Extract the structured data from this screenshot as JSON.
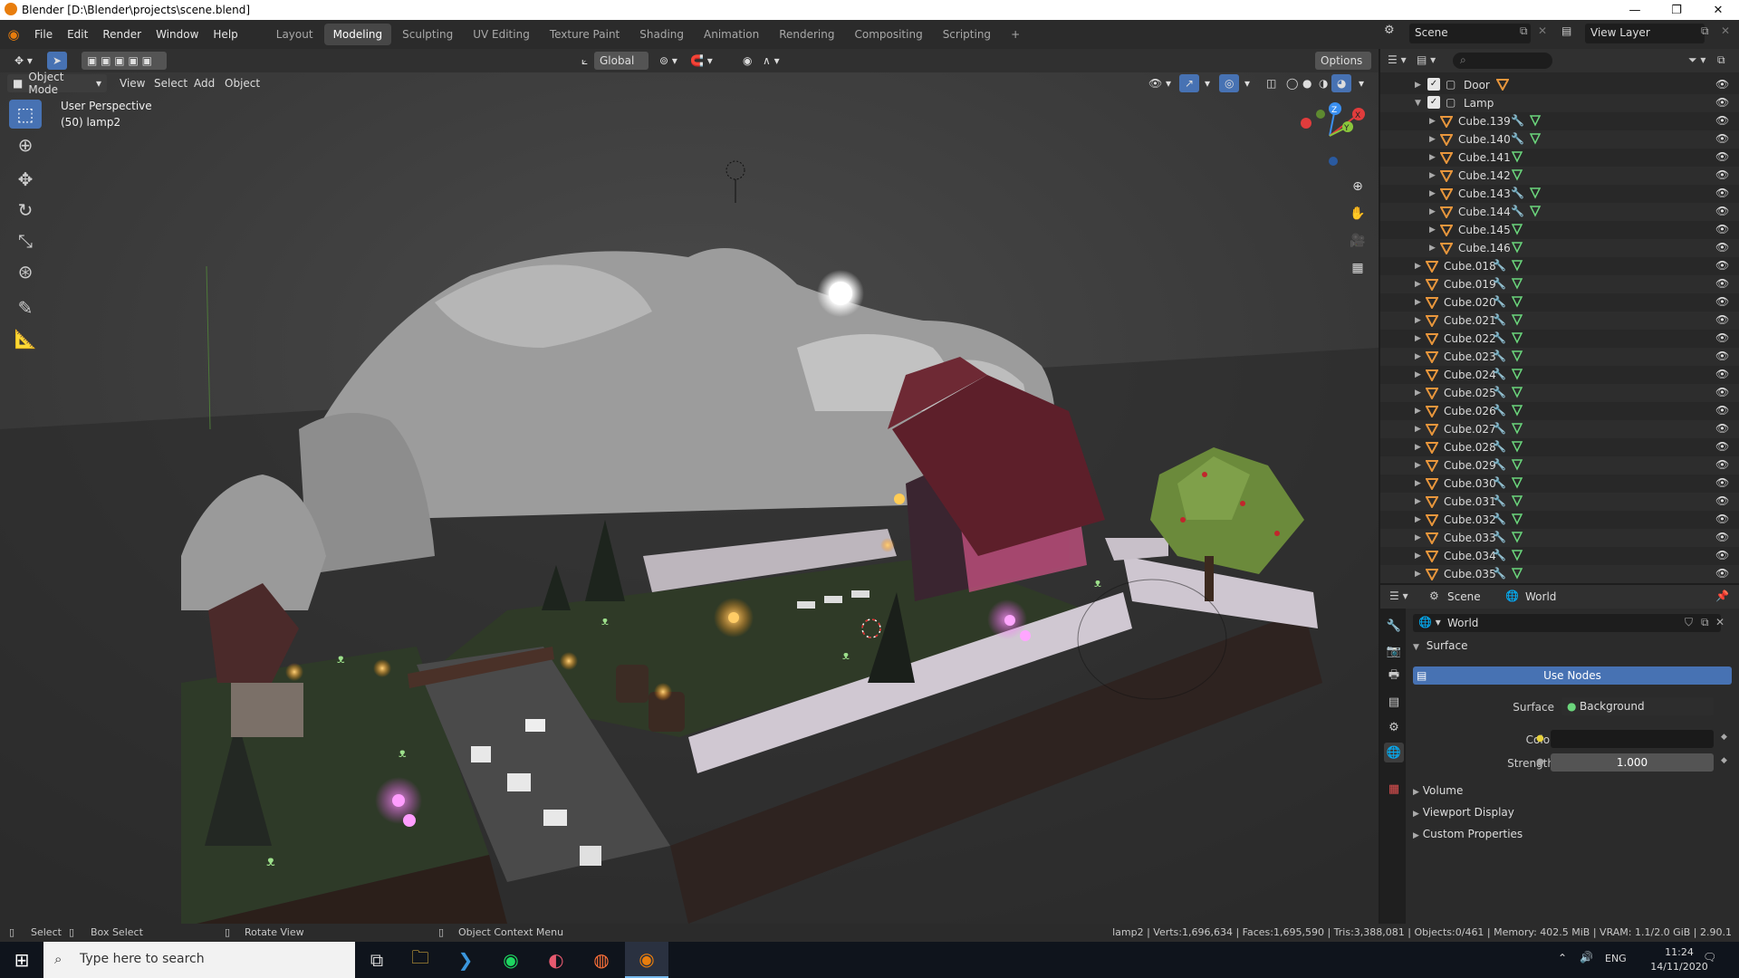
{
  "titlebar": {
    "title": "Blender [D:\\Blender\\projects\\scene.blend]"
  },
  "menu": {
    "items": [
      "File",
      "Edit",
      "Render",
      "Window",
      "Help"
    ]
  },
  "workspaces": {
    "tabs": [
      "Layout",
      "Modeling",
      "Sculpting",
      "UV Editing",
      "Texture Paint",
      "Shading",
      "Animation",
      "Rendering",
      "Compositing",
      "Scripting"
    ],
    "active": "Modeling",
    "add_label": "+"
  },
  "scene_selector": {
    "scene": "Scene",
    "view_layer": "View Layer"
  },
  "viewport": {
    "orientation": "Global",
    "options_label": "Options",
    "mode": "Object Mode",
    "menus": [
      "View",
      "Select",
      "Add",
      "Object"
    ],
    "overlay_line1": "User Perspective",
    "overlay_line2": "(50) lamp2",
    "gizmo": {
      "x": "X",
      "y": "Y",
      "z": "Z"
    }
  },
  "outliner": {
    "collections": [
      {
        "name": "Door",
        "checked": true,
        "expanded": false
      },
      {
        "name": "Lamp",
        "checked": true,
        "expanded": true
      }
    ],
    "lamp_children": [
      {
        "name": "Cube.139",
        "modifier": true
      },
      {
        "name": "Cube.140",
        "modifier": true
      },
      {
        "name": "Cube.141",
        "modifier": false
      },
      {
        "name": "Cube.142",
        "modifier": false
      },
      {
        "name": "Cube.143",
        "modifier": true
      },
      {
        "name": "Cube.144",
        "modifier": true
      },
      {
        "name": "Cube.145",
        "modifier": false
      },
      {
        "name": "Cube.146",
        "modifier": false
      }
    ],
    "objects": [
      "Cube.018",
      "Cube.019",
      "Cube.020",
      "Cube.021",
      "Cube.022",
      "Cube.023",
      "Cube.024",
      "Cube.025",
      "Cube.026",
      "Cube.027",
      "Cube.028",
      "Cube.029",
      "Cube.030",
      "Cube.031",
      "Cube.032",
      "Cube.033",
      "Cube.034",
      "Cube.035"
    ]
  },
  "properties": {
    "breadcrumb_scene": "Scene",
    "breadcrumb_world": "World",
    "world_name": "World",
    "surface_panel": "Surface",
    "use_nodes": "Use Nodes",
    "surface_label": "Surface",
    "surface_value": "Background",
    "color_label": "Color",
    "strength_label": "Strength",
    "strength_value": "1.000",
    "panels": [
      "Volume",
      "Viewport Display",
      "Custom Properties"
    ]
  },
  "statusbar": {
    "select": "Select",
    "box_select": "Box Select",
    "rotate_view": "Rotate View",
    "context_menu": "Object Context Menu",
    "stats": "lamp2 | Verts:1,696,634 | Faces:1,695,590 | Tris:3,388,081 | Objects:0/461 | Memory: 402.5 MiB | VRAM: 1.1/2.0 GiB | 2.90.1"
  },
  "taskbar": {
    "search_placeholder": "Type here to search",
    "lang": "ENG",
    "time": "11:24",
    "date": "14/11/2020"
  },
  "colors": {
    "accent": "#4772b3",
    "mesh_orange": "#e8963c",
    "data_green": "#6bd67c",
    "modifier_blue": "#7aa8e8"
  }
}
